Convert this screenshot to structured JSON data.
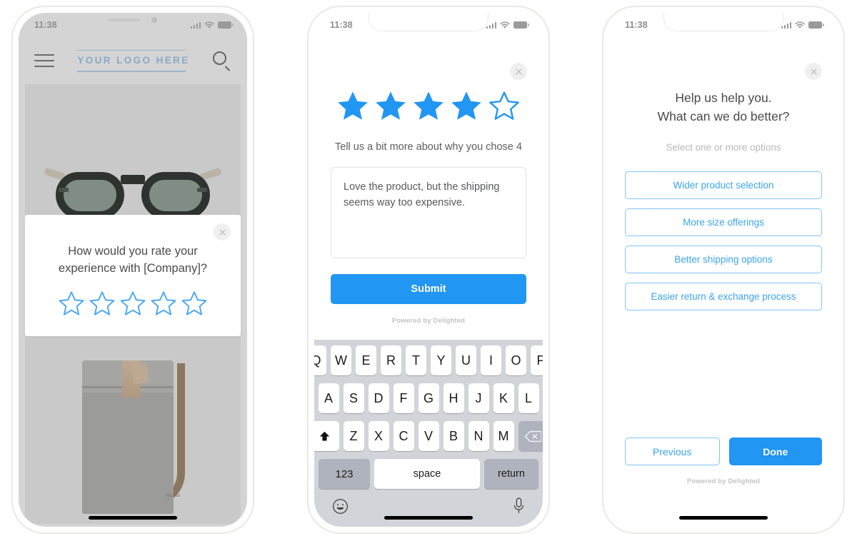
{
  "theme": {
    "accent": "#2196f3",
    "star_outline": "#42a5f5",
    "logo_blue": "#8aa9c4",
    "option_border": "#7fc4f5",
    "screen_gray": "#d4d4d4"
  },
  "status_bar": {
    "time": "11:38",
    "signal_icon": "cellular-bars-icon",
    "wifi_icon": "wifi-icon",
    "battery_icon": "battery-icon"
  },
  "phone1": {
    "header": {
      "menu_icon": "hamburger-menu-icon",
      "logo_text": "YOUR LOGO HERE",
      "search_icon": "search-icon"
    },
    "product_images": {
      "top_alt": "sunglasses-product-image",
      "bottom_alt": "messenger-bag-product-image",
      "bag_brand": "INCASE"
    },
    "modal": {
      "close_icon": "close-icon",
      "question": "How would you rate your experience with [Company]?",
      "stars_total": 5,
      "stars_filled": 0
    }
  },
  "phone2": {
    "close_icon": "close-icon",
    "rating": {
      "stars_total": 5,
      "stars_filled": 4
    },
    "followup_question": "Tell us a bit more about why you chose 4",
    "comment": {
      "value": "Love the product, but the shipping seems way too expensive.",
      "placeholder": ""
    },
    "submit_label": "Submit",
    "powered_by": "Powered by Delighted",
    "keyboard": {
      "row1": [
        "Q",
        "W",
        "E",
        "R",
        "T",
        "Y",
        "U",
        "I",
        "O",
        "P"
      ],
      "row2": [
        "A",
        "S",
        "D",
        "F",
        "G",
        "H",
        "J",
        "K",
        "L"
      ],
      "row3": [
        "Z",
        "X",
        "C",
        "V",
        "B",
        "N",
        "M"
      ],
      "shift_icon": "shift-arrow-icon",
      "backspace_icon": "backspace-icon",
      "numbers_label": "123",
      "space_label": "space",
      "return_label": "return",
      "emoji_icon": "emoji-smiley-icon",
      "mic_icon": "microphone-icon"
    }
  },
  "phone3": {
    "close_icon": "close-icon",
    "title_line1": "Help us help you.",
    "title_line2": "What can we do better?",
    "subtitle": "Select one or more options",
    "options": [
      "Wider product selection",
      "More size offerings",
      "Better shipping options",
      "Easier return & exchange process"
    ],
    "previous_label": "Previous",
    "done_label": "Done",
    "powered_by": "Powered by Delighted"
  }
}
